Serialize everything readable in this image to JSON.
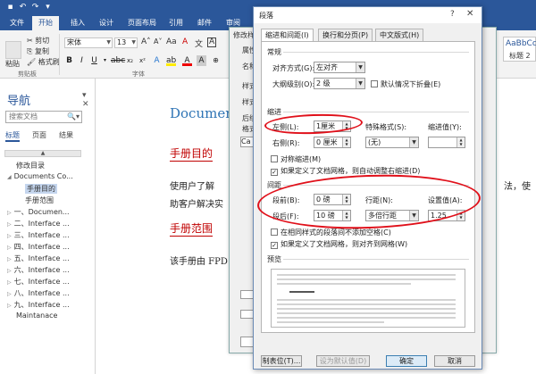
{
  "word": {
    "quick_access": [
      "save-icon",
      "undo-icon",
      "redo-icon",
      "chevron-down-icon"
    ],
    "tabs": [
      "文件",
      "开始",
      "插入",
      "设计",
      "页面布局",
      "引用",
      "邮件",
      "审阅"
    ],
    "clipboard": {
      "paste": "粘贴",
      "cut": "剪切",
      "copy": "复制",
      "format_painter": "格式刷",
      "group": "剪贴板"
    },
    "font": {
      "name": "宋体",
      "size": "13",
      "group": "字体"
    },
    "styles_preview": {
      "style1": "AaBbCc",
      "style2": "标题 2"
    },
    "nav": {
      "title": "导航",
      "search_placeholder": "搜索文档",
      "tabs": [
        "标题",
        "页面",
        "结果"
      ],
      "items": [
        "修改目录",
        "Documents Co...",
        "手册目的",
        "手册范围",
        "一、Documen...",
        "二、Interface ...",
        "三、Interface ...",
        "四、Interface ...",
        "五、Interface ...",
        "六、Interface ...",
        "七、Interface ...",
        "八、Interface ...",
        "九、Interface ...",
        "Maintanace"
      ]
    },
    "doc": {
      "title": "Document",
      "heading1": "手册目的",
      "para1": "使用户了解",
      "para1b": "助客户解决实",
      "para1_right": "法，使",
      "heading2": "手册范围",
      "para2": "该手册由 FPD"
    }
  },
  "styles_dialog": {
    "title": "修改样",
    "labels": [
      "属性",
      "名称",
      "样式",
      "样式",
      "后续",
      "格式",
      "Ca"
    ]
  },
  "paragraph_dialog": {
    "title": "段落",
    "help": "?",
    "close": "✕",
    "tabs": [
      "缩进和间距(I)",
      "换行和分页(P)",
      "中文版式(H)"
    ],
    "general": {
      "section": "常规",
      "alignment_label": "对齐方式(G):",
      "alignment_value": "左对齐",
      "outline_label": "大纲级别(O):",
      "outline_value": "2 级",
      "collapse_label": "默认情况下折叠(E)"
    },
    "indent": {
      "section": "缩进",
      "left_label": "左侧(L):",
      "left_value": "1厘米",
      "right_label": "右侧(R):",
      "right_value": "0 厘米",
      "special_label": "特殊格式(S):",
      "special_value": "(无)",
      "amount_label": "缩进值(Y):",
      "mirror_label": "对称缩进(M)",
      "auto_adjust_label": "如果定义了文档网格，则自动调整右缩进(D)"
    },
    "spacing": {
      "section": "间距",
      "before_label": "段前(B):",
      "before_value": "0 磅",
      "after_label": "段后(F):",
      "after_value": "10 磅",
      "line_label": "行距(N):",
      "line_value": "多倍行距",
      "at_label": "设置值(A):",
      "at_value": "1.25",
      "no_space_label": "在相同样式的段落间不添加空格(C)",
      "snap_grid_label": "如果定义了文档网格，则对齐到网格(W)"
    },
    "preview": {
      "section": "预览"
    },
    "buttons": {
      "tabs": "制表位(T)...",
      "default": "设为默认值(D)",
      "ok": "确定",
      "cancel": "取消"
    },
    "checks": {
      "collapse": false,
      "mirror": false,
      "auto_adjust": true,
      "no_space": false,
      "snap_grid": true
    }
  },
  "annotation_color": "#e0101a"
}
